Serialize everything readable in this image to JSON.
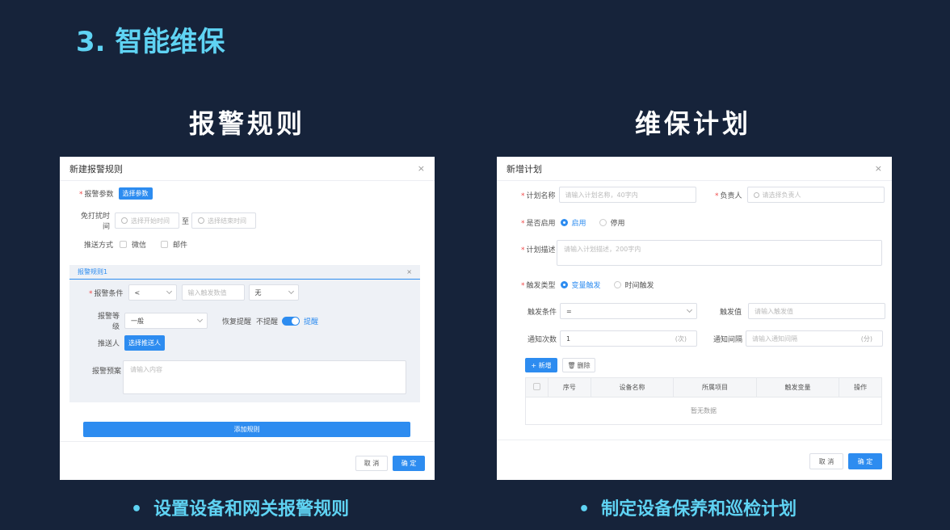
{
  "slide": {
    "title": "3.  智能维保",
    "left_heading": "报警规则",
    "right_heading": "维保计划",
    "left_bullet": "设置设备和网关报警规则",
    "right_bullet": "制定设备保养和巡检计划",
    "bullet_dot": "•"
  },
  "alarm_dialog": {
    "title": "新建报警规则",
    "close": "×",
    "param_label": "报警参数",
    "param_button": "选择参数",
    "quiet_label": "免打扰时间",
    "start_placeholder": "选择开始时间",
    "to": "至",
    "end_placeholder": "选择结束时间",
    "push_label": "推送方式",
    "wechat": "微信",
    "email": "邮件",
    "rule_panel": {
      "title": "报警规则1",
      "close": "×",
      "cond_label": "报警条件",
      "cond_op": "<",
      "threshold_placeholder": "输入触发数值",
      "unit_value": "无",
      "level_label": "报警等级",
      "level_value": "一般",
      "recover_label": "恢复提醒",
      "no_remind": "不提醒",
      "remind": "提醒",
      "pusher_label": "推送人",
      "pusher_button": "选择推送人",
      "plan_label": "报警预案",
      "plan_placeholder": "请输入内容"
    },
    "add_rule": "添加规则",
    "cancel": "取 消",
    "ok": "确 定"
  },
  "plan_dialog": {
    "title": "新增计划",
    "close": "×",
    "name_label": "计划名称",
    "name_placeholder": "请输入计划名称，40字内",
    "owner_label": "负责人",
    "owner_placeholder": "请选择负责人",
    "enable_label": "是否启用",
    "enable_on": "启用",
    "enable_off": "停用",
    "desc_label": "计划描述",
    "desc_placeholder": "请输入计划描述，200字内",
    "trigger_type_label": "触发类型",
    "trigger_var": "变量触发",
    "trigger_time": "时间触发",
    "trigger_cond_label": "触发条件",
    "trigger_cond_value": "=",
    "trigger_val_label": "触发值",
    "trigger_val_placeholder": "请输入触发值",
    "notify_count_label": "通知次数",
    "notify_count_value": "1",
    "notify_count_unit": "(次)",
    "notify_interval_label": "通知间隔",
    "notify_interval_placeholder": "请输入通知间隔",
    "notify_interval_unit": "(分)",
    "add_button": "+ 新增",
    "delete_button": "删除",
    "table": {
      "headers": [
        "序号",
        "设备名称",
        "所属项目",
        "触发变量",
        "操作"
      ],
      "empty": "暂无数据"
    },
    "cancel": "取 消",
    "ok": "确 定"
  },
  "colors": {
    "background": "#16233a",
    "accent_cyan": "#5fd3f3",
    "primary": "#2d8cf0"
  }
}
